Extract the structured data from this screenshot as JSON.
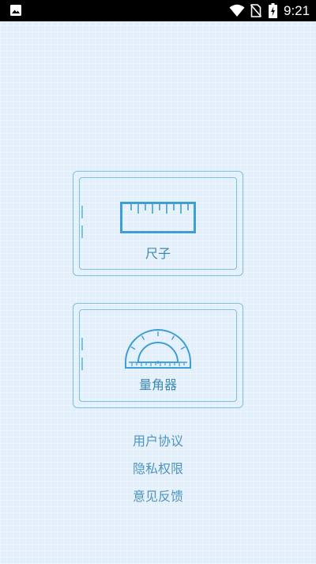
{
  "status_bar": {
    "time": "9:21",
    "icons": [
      "gallery-icon",
      "wifi-icon",
      "no-sim-icon",
      "battery-charging-icon"
    ]
  },
  "tools": {
    "ruler": {
      "label": "尺子",
      "icon": "ruler-icon"
    },
    "protractor": {
      "label": "量角器",
      "icon": "protractor-icon"
    }
  },
  "links": {
    "user_agreement": "用户协议",
    "privacy_permissions": "隐私权限",
    "feedback": "意见反馈"
  },
  "colors": {
    "background": "#e3effb",
    "card_border": "#7fc1d9",
    "icon_stroke": "#3e9fd6",
    "label_text": "#3b8bb0",
    "link_text": "#4d95bf"
  }
}
